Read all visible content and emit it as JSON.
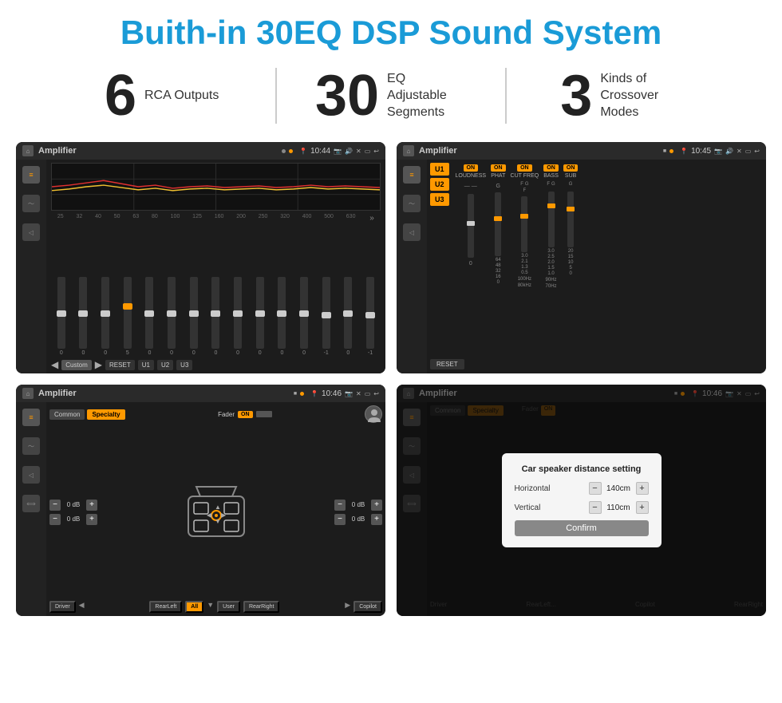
{
  "header": {
    "title": "Buith-in 30EQ DSP Sound System"
  },
  "stats": [
    {
      "number": "6",
      "label": "RCA\nOutputs"
    },
    {
      "number": "30",
      "label": "EQ Adjustable\nSegments"
    },
    {
      "number": "3",
      "label": "Kinds of\nCrossover Modes"
    }
  ],
  "screens": {
    "top_left": {
      "title": "Amplifier",
      "time": "10:44",
      "frequencies": [
        "25",
        "32",
        "40",
        "50",
        "63",
        "80",
        "100",
        "125",
        "160",
        "200",
        "250",
        "320",
        "400",
        "500",
        "630"
      ],
      "values": [
        "0",
        "0",
        "0",
        "5",
        "0",
        "0",
        "0",
        "0",
        "0",
        "0",
        "0",
        "0",
        "-1",
        "0",
        "-1"
      ],
      "preset": "Custom",
      "buttons": [
        "RESET",
        "U1",
        "U2",
        "U3"
      ]
    },
    "top_right": {
      "title": "Amplifier",
      "time": "10:45",
      "u_buttons": [
        "U1",
        "U2",
        "U3"
      ],
      "controls": [
        "LOUDNESS",
        "PHAT",
        "CUT FREQ",
        "BASS",
        "SUB"
      ],
      "reset_label": "RESET"
    },
    "bottom_left": {
      "title": "Amplifier",
      "time": "10:46",
      "tabs": [
        "Common",
        "Specialty"
      ],
      "fader_label": "Fader",
      "on_label": "ON",
      "db_values": [
        "0 dB",
        "0 dB",
        "0 dB",
        "0 dB"
      ],
      "bottom_labels": [
        "Driver",
        "RearLeft",
        "All",
        "User",
        "RearRight",
        "Copilot"
      ]
    },
    "bottom_right": {
      "title": "Amplifier",
      "time": "10:46",
      "dialog": {
        "title": "Car speaker distance setting",
        "horizontal_label": "Horizontal",
        "horizontal_value": "140cm",
        "vertical_label": "Vertical",
        "vertical_value": "110cm",
        "confirm_label": "Confirm"
      }
    }
  }
}
